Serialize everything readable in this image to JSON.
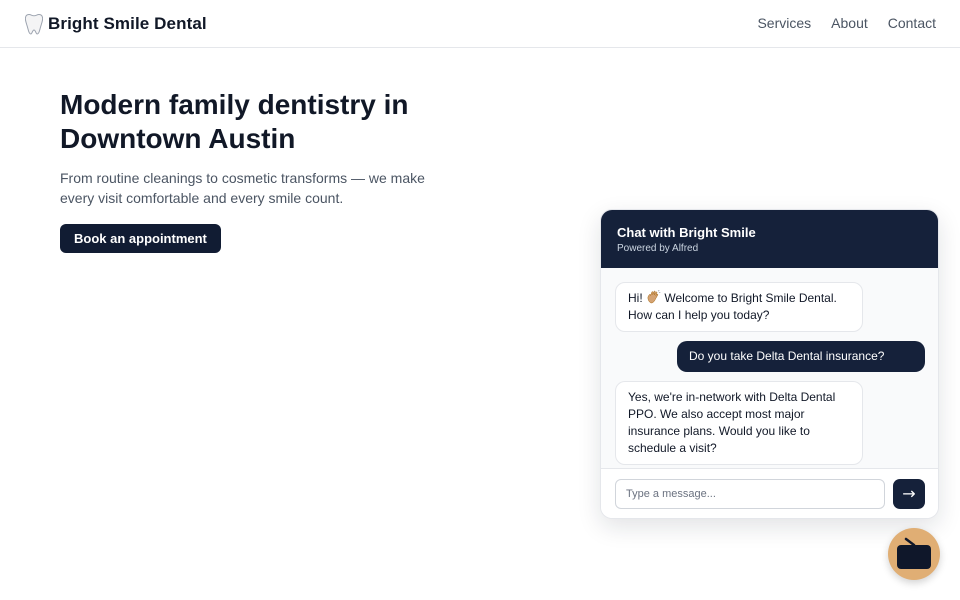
{
  "nav": {
    "brand": "Bright Smile Dental",
    "brand_icon": "tooth-icon",
    "links": [
      "Services",
      "About",
      "Contact"
    ]
  },
  "hero": {
    "title": "Modern family dentistry in Downtown Austin",
    "subtitle": "From routine cleanings to cosmetic transforms — we make every visit comfortable and every smile count.",
    "cta": "Book an appointment"
  },
  "chat": {
    "title": "Chat with Bright Smile",
    "powered_by": "Powered by Alfred",
    "messages": [
      {
        "from": "bot",
        "before_icon": "Hi! ",
        "icon": "waving-hand-icon",
        "text": " Welcome to Bright Smile Dental. How can I help you today?"
      },
      {
        "from": "user",
        "text": "Do you take Delta Dental insurance?"
      },
      {
        "from": "bot",
        "text": "Yes, we're in-network with Delta Dental PPO. We also accept most major insurance plans. Would you like to schedule a visit?"
      }
    ],
    "input_placeholder": "Type a message...",
    "send_label": "→",
    "send_icon": "arrow-right-icon"
  },
  "launcher": {
    "icon": "tv-icon",
    "color": "#e0ae74"
  },
  "colors": {
    "accent": "#15213a",
    "text": "#111827",
    "muted": "#4b5563"
  }
}
